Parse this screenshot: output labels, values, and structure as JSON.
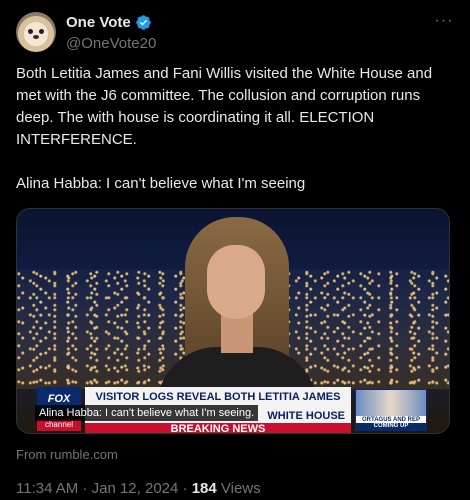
{
  "author": {
    "display_name": "One Vote",
    "handle": "@OneVote20",
    "verified_color": "#1d9bf0"
  },
  "icons": {
    "more": "more-options-icon",
    "verified": "verified-badge-icon"
  },
  "tweet": {
    "text": "Both Letitia James and Fani Willis visited the White House and met with the J6 committee. The collusion and corruption runs deep. The with house is coordinating it all. ELECTION INTERFERENCE.\n\nAlina Habba: I can't believe what I'm seeing"
  },
  "media": {
    "network_logo": "FOX",
    "network_channel": "channel",
    "headline_line1": "VISITOR LOGS REVEAL BOTH LETITIA JAMES",
    "headline_line2": "WHITE HOUSE",
    "breaking": "BREAKING NEWS",
    "promo_caption": "ORTAGUS AND REP WALTZ",
    "promo_coming": "COMING UP",
    "caption": "Alina Habba: I can't believe what I'm seeing."
  },
  "source": "From rumble.com",
  "meta": {
    "time": "11:34 AM",
    "separator1": " · ",
    "date": "Jan 12, 2024",
    "separator2": " · ",
    "views_count": "184",
    "views_label": " Views"
  }
}
